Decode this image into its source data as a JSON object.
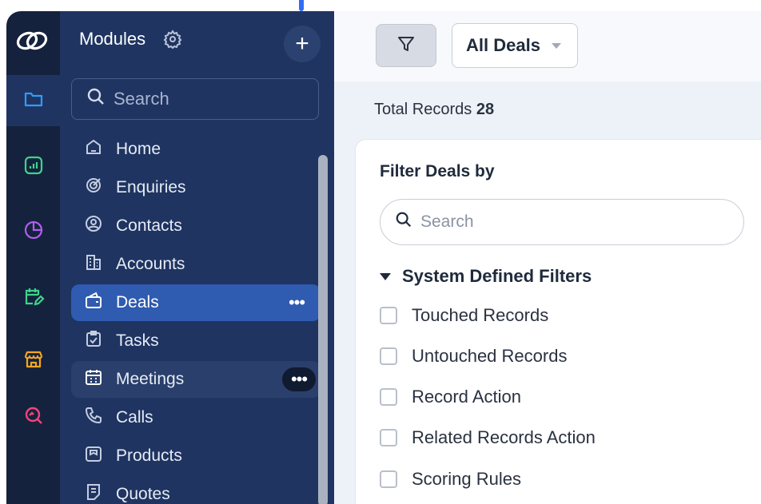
{
  "sidebar_rail": {
    "logo": "zoho-crm-logo",
    "items": [
      {
        "icon": "folder-icon",
        "color": "#2f9dfb",
        "active": true
      },
      {
        "icon": "analytics-icon",
        "color": "#3ed38a",
        "active": false
      },
      {
        "icon": "pie-chart-icon",
        "color": "#b15ef0",
        "active": false
      },
      {
        "icon": "calendar-edit-icon",
        "color": "#3ed38a",
        "active": false
      },
      {
        "icon": "store-icon",
        "color": "#f5a623",
        "active": false
      },
      {
        "icon": "search-analytics-icon",
        "color": "#f0457a",
        "active": false
      }
    ]
  },
  "modules_panel": {
    "title": "Modules",
    "add_label": "+",
    "search_placeholder": "Search",
    "items": [
      {
        "label": "Home",
        "icon": "home-icon"
      },
      {
        "label": "Enquiries",
        "icon": "enquiries-icon"
      },
      {
        "label": "Contacts",
        "icon": "contacts-icon"
      },
      {
        "label": "Accounts",
        "icon": "accounts-icon"
      },
      {
        "label": "Deals",
        "icon": "wallet-icon",
        "state": "active",
        "more": "•••"
      },
      {
        "label": "Tasks",
        "icon": "tasks-icon"
      },
      {
        "label": "Meetings",
        "icon": "meetings-icon",
        "state": "hover",
        "more": "•••"
      },
      {
        "label": "Calls",
        "icon": "phone-icon"
      },
      {
        "label": "Products",
        "icon": "products-icon"
      },
      {
        "label": "Quotes",
        "icon": "quotes-icon"
      }
    ]
  },
  "toolbar": {
    "view_label": "All Deals"
  },
  "summary": {
    "total_label": "Total Records",
    "total_value": "28"
  },
  "filter_panel": {
    "title": "Filter Deals by",
    "search_placeholder": "Search",
    "section_title": "System Defined Filters",
    "options": [
      {
        "label": "Touched Records",
        "checked": false
      },
      {
        "label": "Untouched Records",
        "checked": false
      },
      {
        "label": "Record Action",
        "checked": false
      },
      {
        "label": "Related Records Action",
        "checked": false
      },
      {
        "label": "Scoring Rules",
        "checked": false
      }
    ]
  }
}
